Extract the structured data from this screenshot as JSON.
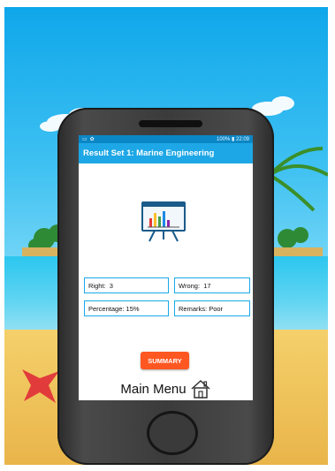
{
  "status_bar": {
    "right_text": "100% ▮ 22:09"
  },
  "app_bar": {
    "title": "Result Set 1: Marine Engineering"
  },
  "results": {
    "right_label": "Right:",
    "right_value": "3",
    "wrong_label": "Wrong:",
    "wrong_value": "17",
    "percentage_label": "Percentage:",
    "percentage_value": "15%",
    "remarks_label": "Remarks:",
    "remarks_value": "Poor"
  },
  "buttons": {
    "summary": "SUMMARY",
    "main_menu": "Main Menu"
  },
  "icons": {
    "result": "presentation-chart-icon",
    "home": "house-icon"
  },
  "colors": {
    "status_bar": "#0b86c4",
    "app_bar": "#1ea7e6",
    "border": "#1aa9e8",
    "summary_button": "#ff5722",
    "phone_body": "#3b3b3b"
  }
}
